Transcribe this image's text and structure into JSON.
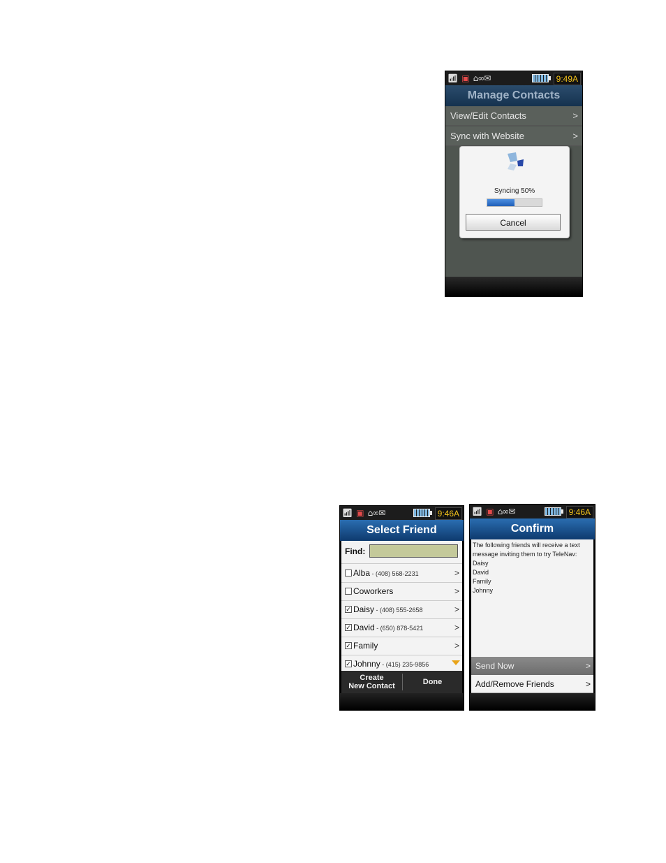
{
  "phone1": {
    "status": {
      "time": "9:49A"
    },
    "title": "Manage Contacts",
    "menu": [
      {
        "label": "View/Edit Contacts",
        "chevron": ">"
      },
      {
        "label": "Sync with Website",
        "chevron": ">"
      }
    ],
    "dialog": {
      "status_text": "Syncing  50%",
      "progress": 0.5,
      "cancel_label": "Cancel"
    }
  },
  "phone2": {
    "status": {
      "time": "9:46A"
    },
    "title": "Select Friend",
    "find_label": "Find:",
    "find_value": "",
    "friends": [
      {
        "name": "Alba",
        "phone": " - (408) 568-2231",
        "checked": false,
        "chevron": ">"
      },
      {
        "name": "Coworkers",
        "phone": "",
        "checked": false,
        "chevron": ">"
      },
      {
        "name": "Daisy",
        "phone": " - (408) 555-2658",
        "checked": true,
        "chevron": ">"
      },
      {
        "name": "David",
        "phone": " - (650) 878-5421",
        "checked": true,
        "chevron": ">"
      },
      {
        "name": "Family",
        "phone": "",
        "checked": true,
        "chevron": ">"
      },
      {
        "name": "Johnny",
        "phone": " - (415) 235-9856",
        "checked": true,
        "chevron": ""
      }
    ],
    "softkeys": {
      "left_line1": "Create",
      "left_line2": "New Contact",
      "right": "Done"
    }
  },
  "phone3": {
    "status": {
      "time": "9:46A"
    },
    "title": "Confirm",
    "message": "The following friends will receive a text message inviting them to try TeleNav:",
    "recipients": [
      "Daisy",
      "David",
      "Family",
      "Johnny"
    ],
    "actions": [
      {
        "label": "Send Now",
        "chevron": ">"
      },
      {
        "label": "Add/Remove Friends",
        "chevron": ">"
      }
    ]
  },
  "colors": {
    "title_blue": "#1f5a96",
    "clock_yellow": "#f2c21b",
    "find_field": "#c4c99a",
    "progress_blue": "#2f74cc"
  }
}
